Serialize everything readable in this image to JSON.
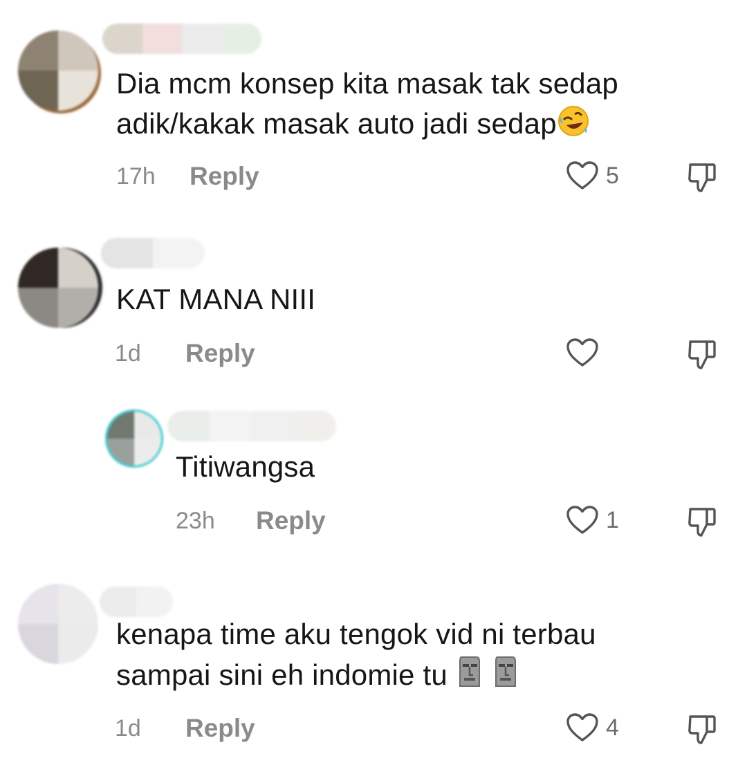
{
  "comments": [
    {
      "text": "Dia mcm konsep kita masak tak sedap\nadik/kakak masak auto jadi sedap",
      "emoji": "rolling-on-floor-laughing",
      "time": "17h",
      "reply_label": "Reply",
      "likes": "5"
    },
    {
      "text": "KAT MANA NIII",
      "time": "1d",
      "reply_label": "Reply",
      "likes": ""
    },
    {
      "text": "Titiwangsa",
      "time": "23h",
      "reply_label": "Reply",
      "likes": "1"
    },
    {
      "text": "kenapa time aku tengok vid ni terbau\nsampai sini eh indomie tu",
      "emoji": "moai",
      "time": "1d",
      "reply_label": "Reply",
      "likes": "4"
    }
  ]
}
